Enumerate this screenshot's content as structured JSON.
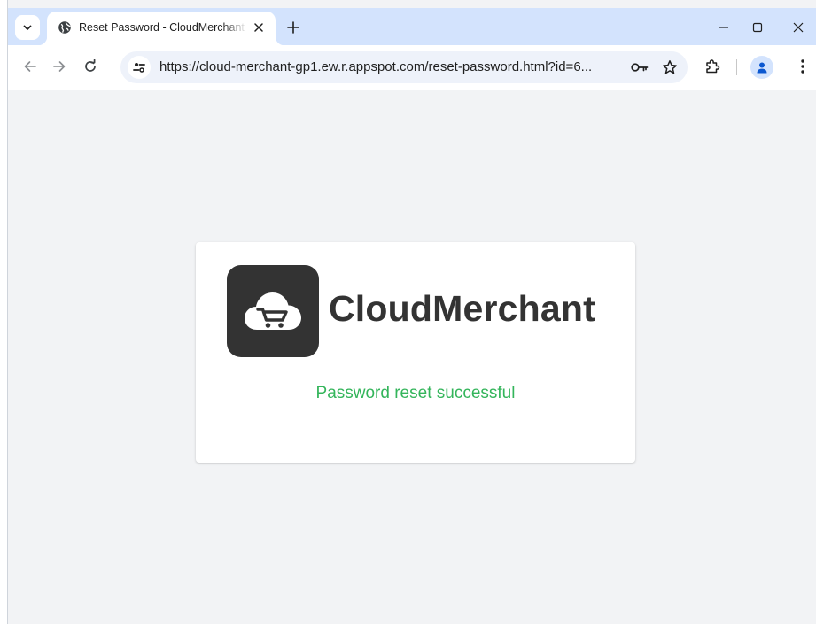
{
  "browser": {
    "tab": {
      "title": "Reset Password - CloudMerchant",
      "favicon": "globe-icon",
      "close_icon": "close-icon"
    },
    "new_tab_icon": "plus-icon",
    "tab_search_icon": "chevron-down-icon",
    "window_controls": [
      "minimize-icon",
      "maximize-icon",
      "close-icon"
    ],
    "toolbar": {
      "back_icon": "back-arrow-icon",
      "forward_icon": "forward-arrow-icon",
      "reload_icon": "reload-icon",
      "site_info_icon": "tune-icon",
      "url": "https://cloud-merchant-gp1.ew.r.appspot.com/reset-password.html?id=6...",
      "password_key_icon": "key-icon",
      "bookmark_icon": "star-icon",
      "extensions_icon": "puzzle-icon",
      "profile_icon": "person-icon",
      "menu_icon": "more-vertical-icon"
    }
  },
  "page": {
    "logo_icon": "cloud-cart-icon",
    "brand_name": "CloudMerchant",
    "status_message": "Password reset successful",
    "colors": {
      "background": "#f2f3f5",
      "card": "#ffffff",
      "logo_bg": "#333333",
      "brand_text": "#333333",
      "success_text": "#34b55b",
      "tabstrip": "#d3e3fd"
    }
  }
}
